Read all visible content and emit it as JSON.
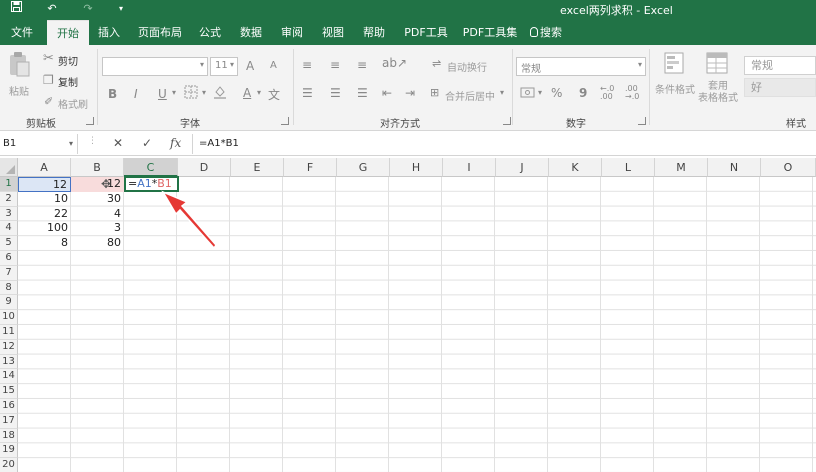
{
  "title": "excel两列求积 - Excel",
  "quick_access": [
    "save-icon",
    "undo-icon",
    "redo-icon",
    "customize-icon"
  ],
  "tabs": [
    "文件",
    "开始",
    "插入",
    "页面布局",
    "公式",
    "数据",
    "审阅",
    "视图",
    "帮助",
    "PDF工具",
    "PDF工具集",
    "搜索"
  ],
  "active_tab": "开始",
  "ribbon": {
    "clipboard": {
      "paste": "粘贴",
      "cut": "剪切",
      "copy": "复制",
      "format_painter": "格式刷",
      "label": "剪贴板"
    },
    "font": {
      "size": "11",
      "label": "字体",
      "bold": "B",
      "italic": "I",
      "underline": "U",
      "grow": "A",
      "shrink": "A",
      "font_color": "A",
      "phonetic": "文"
    },
    "alignment": {
      "wrap": "自动换行",
      "merge": "合并后居中",
      "label": "对齐方式"
    },
    "number": {
      "format": "常规",
      "percent": "%",
      "comma": "9",
      "inc_dec": "←.0 .00",
      "dec_dec": ".00 →.0",
      "label": "数字"
    },
    "styles": {
      "conditional": "条件格式",
      "table_format": "套用\n表格格式",
      "normal": "常规",
      "good": "好",
      "label": "样式"
    }
  },
  "formula_bar": {
    "name_box": "B1",
    "cancel": "✕",
    "enter": "✓",
    "fx": "fx",
    "formula": "=A1*B1"
  },
  "columns": [
    "A",
    "B",
    "C",
    "D",
    "E",
    "F",
    "G",
    "H",
    "I",
    "J",
    "K",
    "L",
    "M",
    "N",
    "O"
  ],
  "rows": [
    "1",
    "2",
    "3",
    "4",
    "5",
    "6",
    "7",
    "8",
    "9",
    "10",
    "11",
    "12",
    "13",
    "14",
    "15",
    "16",
    "17",
    "18",
    "19",
    "20"
  ],
  "cells": {
    "A": [
      "12",
      "10",
      "22",
      "100",
      "8"
    ],
    "B": [
      "12",
      "30",
      "4",
      "3",
      "80"
    ]
  },
  "editing_cell": {
    "eq": "=",
    "ref_a": "A1",
    "op": "*",
    "ref_b": "B1"
  },
  "colors": {
    "accent": "#217346",
    "ref_a": "#4472c4",
    "ref_b": "#e06666",
    "arrow": "#e53935"
  }
}
